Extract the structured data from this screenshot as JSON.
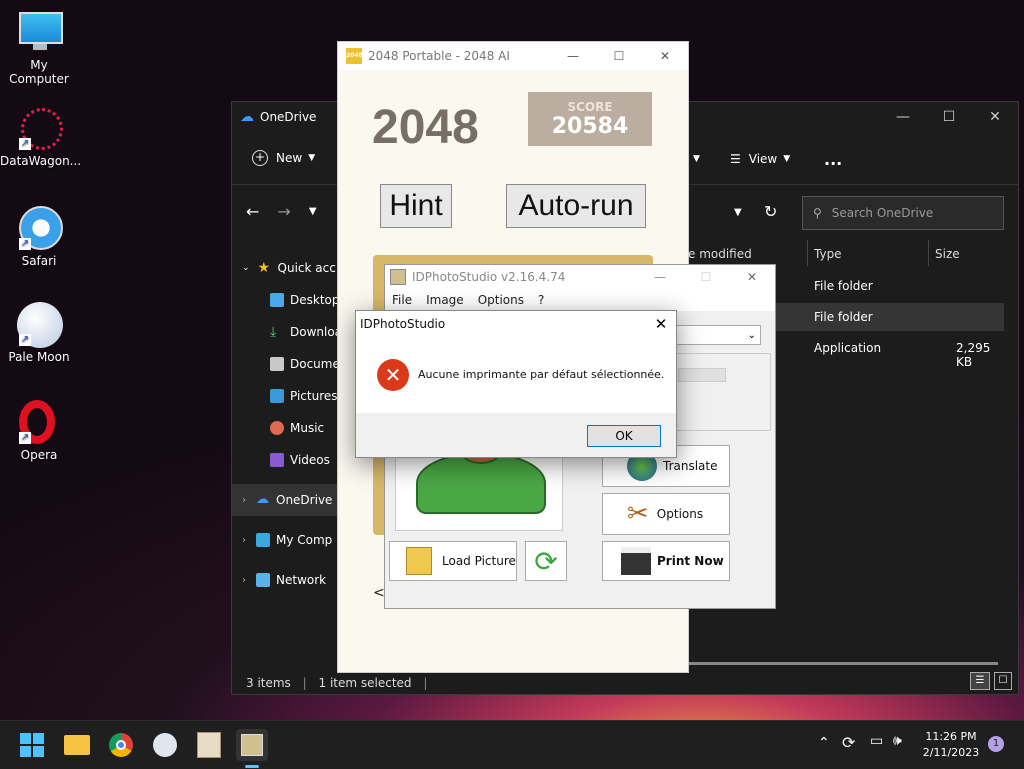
{
  "desktop": {
    "icons": [
      {
        "label": "My Computer"
      },
      {
        "label": "DataWagon..."
      },
      {
        "label": "Safari"
      },
      {
        "label": "Pale Moon"
      },
      {
        "label": "Opera"
      }
    ]
  },
  "explorer": {
    "title": "OneDrive",
    "toolbar": {
      "new_label": "New",
      "view_label": "View",
      "more_label": "..."
    },
    "search_placeholder": "Search OneDrive",
    "columns": {
      "modified": "e modified",
      "type": "Type",
      "size": "Size"
    },
    "rows": [
      {
        "type": "File folder",
        "size": ""
      },
      {
        "type": "File folder",
        "size": ""
      },
      {
        "type": "Application",
        "size": "2,295 KB"
      }
    ],
    "nav": {
      "quick_access": "Quick acc",
      "desktop": "Desktop",
      "downloads": "Downloa",
      "documents": "Docume",
      "pictures": "Pictures",
      "music": "Music",
      "videos": "Videos",
      "onedrive": "OneDrive",
      "my_computer": "My Comp",
      "network": "Network"
    },
    "status": {
      "items": "3 items",
      "selected": "1 item selected"
    }
  },
  "game2048": {
    "title": "2048 Portable - 2048 AI",
    "logo": "2048",
    "score_label": "SCORE",
    "score_value": "20584",
    "hint_label": "Hint",
    "autorun_label": "Auto-run"
  },
  "idphoto": {
    "title": "IDPhotoStudio v2.16.4.74",
    "menu": {
      "file": "File",
      "image": "Image",
      "options": "Options",
      "help": "?"
    },
    "buttons": {
      "translate": "Translate",
      "options": "Options",
      "load": "Load Picture",
      "print": "Print Now"
    },
    "back_arrow": "<"
  },
  "dialog": {
    "title": "IDPhotoStudio",
    "message": "Aucune imprimante par défaut sélectionnée.",
    "ok_label": "OK"
  },
  "taskbar": {
    "time": "11:26 PM",
    "date": "2/11/2023",
    "notification_count": "1"
  }
}
